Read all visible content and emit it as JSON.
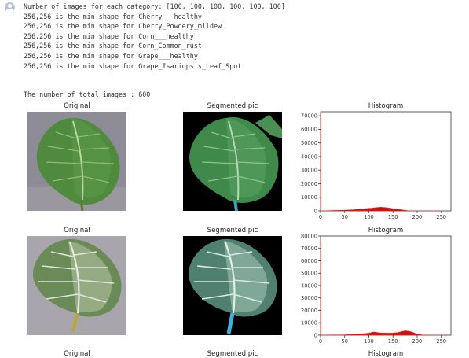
{
  "log_lines": [
    "Number of images for each category: [100, 100, 100, 100, 100, 100]",
    "256,256 is the min shape for Cherry___healthy",
    "256,256 is the min shape for Cherry_Powdery_mildew",
    "256,256 is the min shape for Corn___healthy",
    "256,256 is the min shape for Corn_Common_rust",
    "256,256 is the min shape for Grape___healthy",
    "256,256 is the min shape for Grape_Isariopsis_Leaf_Spot"
  ],
  "total_images_text": "The number of total images : 600",
  "titles": {
    "original": "Original",
    "segmented": "Segmented pic",
    "histogram": "Histogram"
  },
  "colors": {
    "histogram_line": "#ff2020",
    "histogram_fill": "#cc1010",
    "output_icon": "#b7c2da"
  },
  "chart_data": [
    {
      "type": "area",
      "title": "Histogram",
      "xlim": [
        0,
        270
      ],
      "ylim": [
        0,
        73000
      ],
      "x_ticks": [
        0,
        50,
        100,
        150,
        200,
        250
      ],
      "y_ticks": [
        0,
        10000,
        20000,
        30000,
        40000,
        50000,
        60000,
        70000
      ],
      "series": [
        {
          "x": [
            0,
            1,
            2,
            5,
            10,
            20,
            30,
            40,
            50,
            60,
            70,
            80,
            85,
            90,
            95,
            100,
            105,
            110,
            115,
            120,
            125,
            130,
            135,
            140,
            145,
            150,
            155,
            160,
            165,
            170,
            175,
            180,
            190,
            200,
            255
          ],
          "y": [
            70000,
            70000,
            0,
            0,
            100,
            200,
            300,
            400,
            500,
            700,
            900,
            1200,
            1400,
            1500,
            1700,
            1900,
            2000,
            2200,
            2400,
            2600,
            2700,
            2600,
            2400,
            2200,
            1900,
            1600,
            1400,
            1200,
            1000,
            700,
            400,
            200,
            100,
            0,
            0
          ]
        }
      ]
    },
    {
      "type": "area",
      "title": "Histogram",
      "xlim": [
        0,
        270
      ],
      "ylim": [
        0,
        80000
      ],
      "x_ticks": [
        0,
        50,
        100,
        150,
        200,
        250
      ],
      "y_ticks": [
        0,
        10000,
        20000,
        30000,
        40000,
        50000,
        60000,
        70000,
        80000
      ],
      "series": [
        {
          "x": [
            0,
            1,
            2,
            5,
            10,
            30,
            50,
            60,
            70,
            80,
            90,
            100,
            105,
            110,
            115,
            120,
            125,
            130,
            140,
            150,
            160,
            165,
            170,
            175,
            180,
            185,
            190,
            195,
            200,
            210,
            255
          ],
          "y": [
            76000,
            76000,
            0,
            0,
            100,
            200,
            300,
            500,
            700,
            900,
            1200,
            1600,
            2100,
            2600,
            2300,
            2000,
            1800,
            1700,
            1600,
            1700,
            2100,
            2600,
            3100,
            3500,
            3300,
            2900,
            2400,
            1600,
            900,
            200,
            0
          ]
        }
      ]
    }
  ]
}
